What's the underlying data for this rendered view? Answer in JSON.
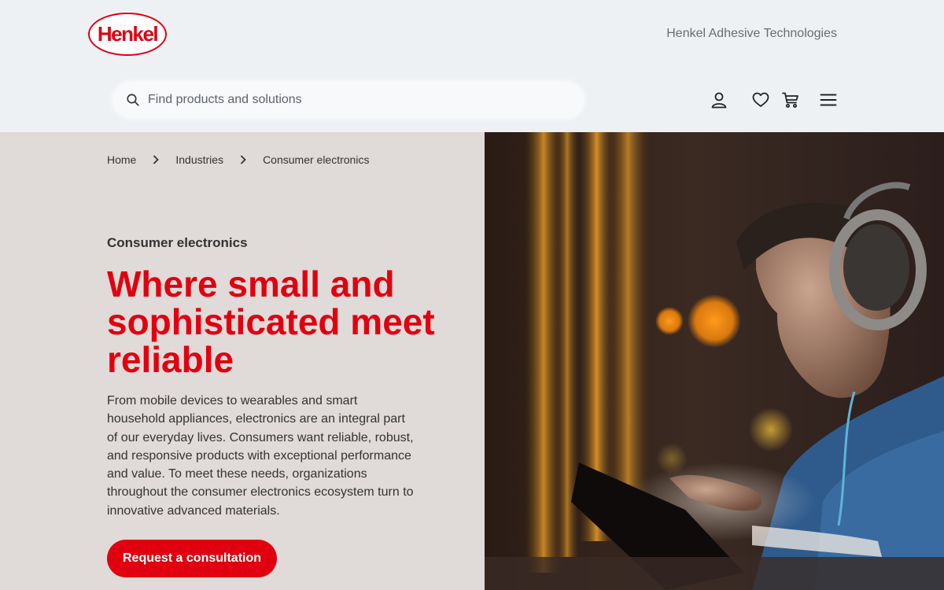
{
  "header": {
    "logo_text": "Henkel",
    "tagline": "Henkel Adhesive Technologies"
  },
  "search": {
    "placeholder": "Find products and solutions"
  },
  "icons": [
    "search-icon",
    "user-icon",
    "heart-icon",
    "cart-icon",
    "menu-icon"
  ],
  "breadcrumb": {
    "items": [
      "Home",
      "Industries",
      "Consumer electronics"
    ]
  },
  "hero": {
    "eyebrow": "Consumer electronics",
    "headline": "Where small and sophisticated meet reliable",
    "body": "From mobile devices to wearables and smart household appliances, electronics are an integral part of our everyday lives. Consumers want reliable, robust, and responsive products with exceptional performance and value. To meet these needs, organizations throughout the consumer electronics ecosystem turn to innovative advanced materials.",
    "cta_label": "Request a consultation"
  },
  "colors": {
    "brand_red": "#e1000f",
    "header_bg": "#eef1f4",
    "panel_bg": "#e0dad8"
  }
}
